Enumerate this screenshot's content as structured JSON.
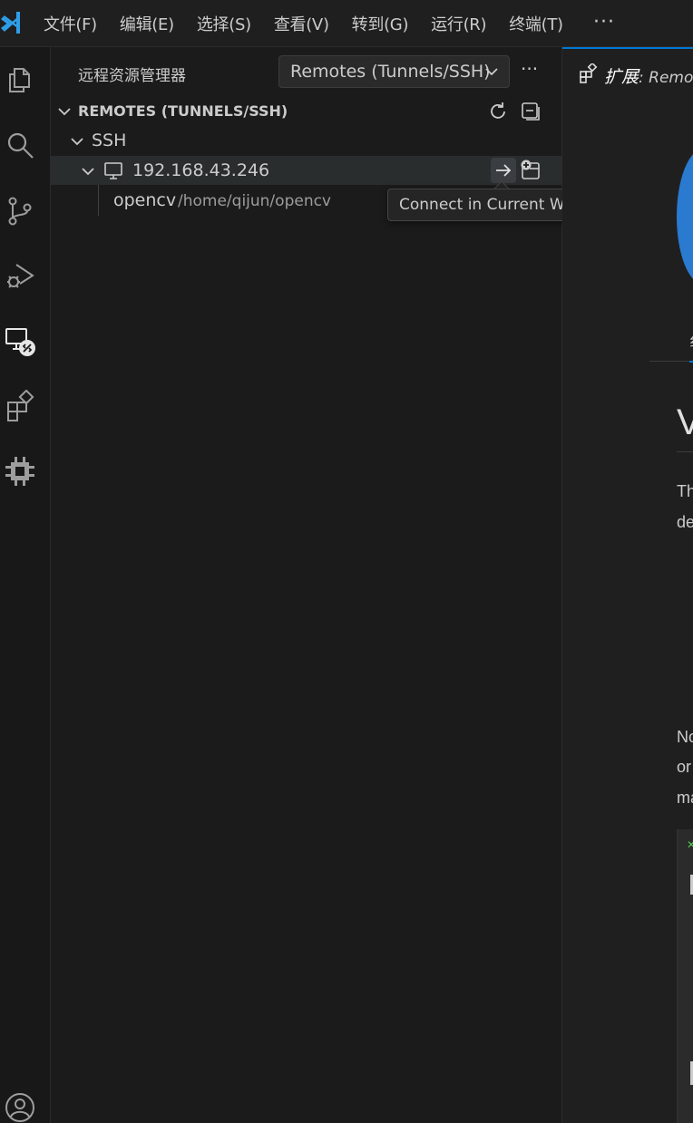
{
  "menubar": {
    "items": [
      "文件(F)",
      "编辑(E)",
      "选择(S)",
      "查看(V)",
      "转到(G)",
      "运行(R)",
      "终端(T)"
    ],
    "more": "···"
  },
  "activitybar": {
    "icons": [
      "explorer-icon",
      "search-icon",
      "source-control-icon",
      "run-debug-icon",
      "remote-explorer-icon",
      "extensions-icon",
      "chip-icon",
      "account-icon"
    ]
  },
  "sidebar": {
    "title": "远程资源管理器",
    "select_value": "Remotes (Tunnels/SSH)",
    "more": "···",
    "section_label": "REMOTES (TUNNELS/SSH)",
    "tree": {
      "group_label": "SSH",
      "host_label": "192.168.43.246",
      "folder_label": "opencv",
      "folder_path": "/home/qijun/opencv"
    },
    "tooltip": "Connect in Current Window..."
  },
  "editor": {
    "tab_title": "扩展",
    "tab_subtitle": ": Remo",
    "tab_char": "纟",
    "heading": "V",
    "paragraph_lines": [
      "Th",
      "de"
    ],
    "paragraph2_lines": [
      "No",
      "or",
      "ma"
    ]
  },
  "colors": {
    "accent": "#0078d4",
    "vscode_blue": "#2f9ee8"
  }
}
